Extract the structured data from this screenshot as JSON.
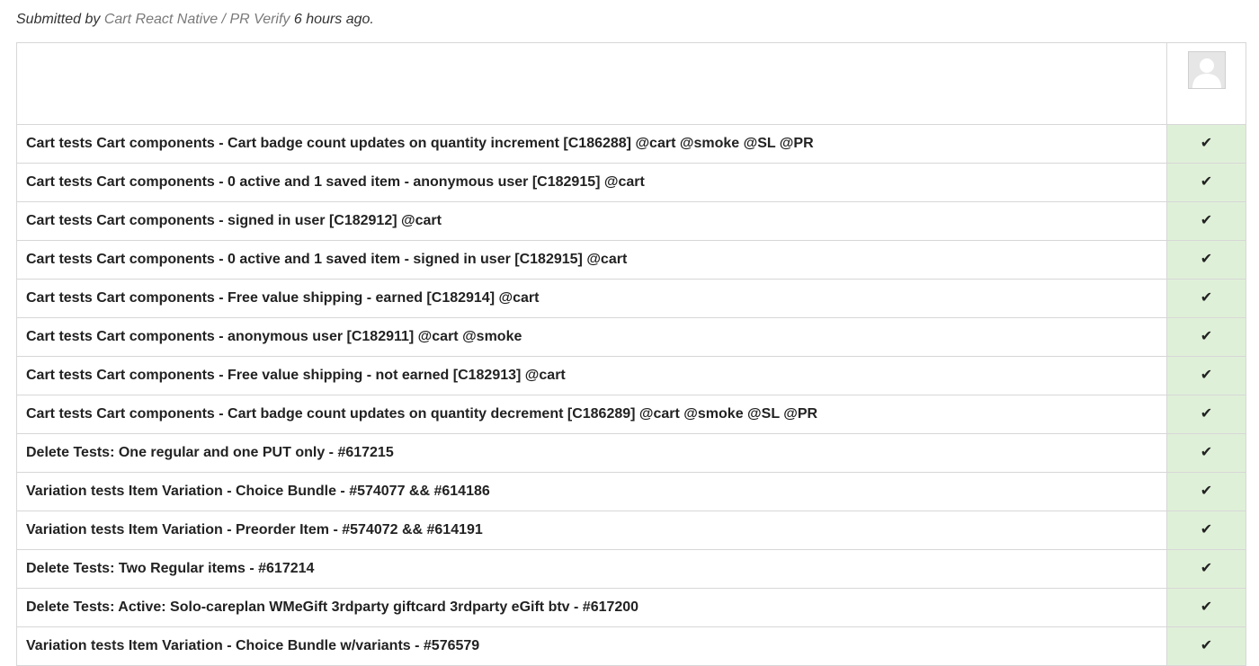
{
  "submission": {
    "prefix": "Submitted by",
    "author": "Cart React Native / PR Verify",
    "time": "6 hours ago",
    "suffix": "."
  },
  "header": {
    "avatar_icon": "user-avatar-icon"
  },
  "status_icon": "✔",
  "colors": {
    "pass_background": "#dff0d8",
    "link_gray": "#7a7a7a",
    "border": "#d7d7d7"
  },
  "tests": [
    {
      "name": "Cart tests Cart components - Cart badge count updates on quantity increment [C186288] @cart @smoke @SL @PR",
      "status": "passed"
    },
    {
      "name": "Cart tests Cart components - 0 active and 1 saved item - anonymous user [C182915] @cart",
      "status": "passed"
    },
    {
      "name": "Cart tests Cart components - signed in user [C182912] @cart",
      "status": "passed"
    },
    {
      "name": "Cart tests Cart components - 0 active and 1 saved item - signed in user [C182915] @cart",
      "status": "passed"
    },
    {
      "name": "Cart tests Cart components - Free value shipping - earned [C182914] @cart",
      "status": "passed"
    },
    {
      "name": "Cart tests Cart components - anonymous user [C182911] @cart @smoke",
      "status": "passed"
    },
    {
      "name": "Cart tests Cart components - Free value shipping - not earned [C182913] @cart",
      "status": "passed"
    },
    {
      "name": "Cart tests Cart components - Cart badge count updates on quantity decrement [C186289] @cart @smoke @SL @PR",
      "status": "passed"
    },
    {
      "name": "Delete Tests: One regular and one PUT only - #617215",
      "status": "passed"
    },
    {
      "name": "Variation tests Item Variation - Choice Bundle - #574077 && #614186",
      "status": "passed"
    },
    {
      "name": "Variation tests Item Variation - Preorder Item - #574072 && #614191",
      "status": "passed"
    },
    {
      "name": "Delete Tests: Two Regular items - #617214",
      "status": "passed"
    },
    {
      "name": "Delete Tests: Active: Solo-careplan WMeGift 3rdparty giftcard 3rdparty eGift btv - #617200",
      "status": "passed"
    },
    {
      "name": "Variation tests Item Variation - Choice Bundle w/variants - #576579",
      "status": "passed"
    }
  ]
}
